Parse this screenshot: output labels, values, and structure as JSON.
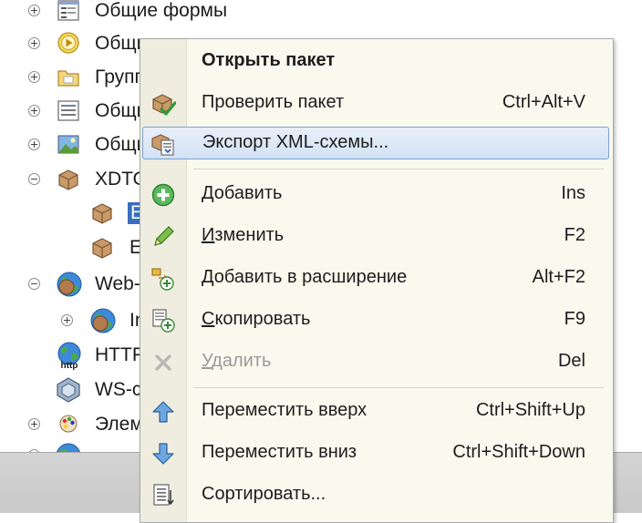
{
  "tree": {
    "items": [
      {
        "label": "Общие формы",
        "expander": "plus",
        "icon": "forms-icon"
      },
      {
        "label": "Общи",
        "expander": "plus",
        "icon": "play-circle-icon"
      },
      {
        "label": "Групп",
        "expander": "plus",
        "icon": "folder-icon"
      },
      {
        "label": "Общи",
        "expander": "plus",
        "icon": "list-icon"
      },
      {
        "label": "Общи",
        "expander": "plus",
        "icon": "picture-icon"
      },
      {
        "label": "XDTO",
        "expander": "minus",
        "icon": "package-icon"
      },
      {
        "label": "E",
        "expander": "",
        "icon": "package-icon"
      },
      {
        "label": "E",
        "expander": "",
        "icon": "package-icon"
      },
      {
        "label": "Web-",
        "expander": "minus",
        "icon": "globe-icon"
      },
      {
        "label": "In",
        "expander": "plus",
        "icon": "globe-icon"
      },
      {
        "label": "HTTP",
        "expander": "",
        "icon": "http-globe-icon"
      },
      {
        "label": "WS-c",
        "expander": "",
        "icon": "ws-icon"
      },
      {
        "label": "Элем",
        "expander": "plus",
        "icon": "palette-icon"
      }
    ],
    "http_badge": "http"
  },
  "menu": {
    "items": [
      {
        "label": "Открыть пакет",
        "shortcut": "",
        "bold": true
      },
      {
        "label": "Проверить пакет",
        "shortcut": "Ctrl+Alt+V"
      },
      {
        "label": "Экспорт XML-схемы...",
        "shortcut": "",
        "highlighted": true
      },
      {
        "label": "Добавить",
        "accel": "Д",
        "rest": "обавить",
        "shortcut": "Ins"
      },
      {
        "label": "Изменить",
        "accel": "И",
        "rest": "зменить",
        "shortcut": "F2"
      },
      {
        "label": "Добавить в расширение",
        "accel": "Д",
        "rest": "обавить в расширение",
        "shortcut": "Alt+F2"
      },
      {
        "label": "Скопировать",
        "accel": "С",
        "rest": "копировать",
        "shortcut": "F9"
      },
      {
        "label": "Удалить",
        "accel": "У",
        "rest": "далить",
        "shortcut": "Del",
        "disabled": true
      },
      {
        "label": "Переместить вверх",
        "shortcut": "Ctrl+Shift+Up"
      },
      {
        "label": "Переместить вниз",
        "shortcut": "Ctrl+Shift+Down"
      },
      {
        "label": "Сортировать...",
        "shortcut": ""
      }
    ]
  },
  "colors": {
    "menu_bg": "#faf9ee",
    "gutter_bg": "#efeddf",
    "highlight_border": "#7da2ce",
    "disabled_text": "#9a9a9a"
  }
}
